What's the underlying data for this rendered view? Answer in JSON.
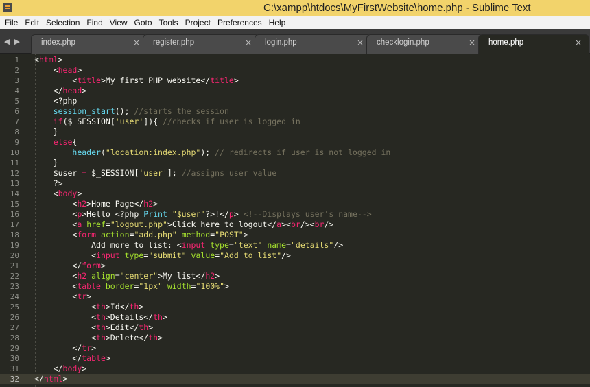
{
  "window": {
    "title": "C:\\xampp\\htdocs\\MyFirstWebsite\\home.php - Sublime Text"
  },
  "menu": [
    "File",
    "Edit",
    "Selection",
    "Find",
    "View",
    "Goto",
    "Tools",
    "Project",
    "Preferences",
    "Help"
  ],
  "tabs": [
    {
      "label": "index.php",
      "active": false
    },
    {
      "label": "register.php",
      "active": false
    },
    {
      "label": "login.php",
      "active": false
    },
    {
      "label": "checklogin.php",
      "active": false
    },
    {
      "label": "home.php",
      "active": true
    }
  ],
  "editor": {
    "current_line": 32,
    "lines": [
      "<html>",
      "    <head>",
      "        <title>My first PHP website</title>",
      "    </head>",
      "    <?php",
      "    session_start(); //starts the session",
      "    if($_SESSION['user']){ //checks if user is logged in",
      "    }",
      "    else{",
      "        header(\"location:index.php\"); // redirects if user is not logged in",
      "    }",
      "    $user = $_SESSION['user']; //assigns user value",
      "    ?>",
      "    <body>",
      "        <h2>Home Page</h2>",
      "        <p>Hello <?php Print \"$user\"?>!</p> <!--Displays user's name-->",
      "        <a href=\"logout.php\">Click here to logout</a><br/><br/>",
      "        <form action=\"add.php\" method=\"POST\">",
      "            Add more to list: <input type=\"text\" name=\"details\"/>",
      "            <input type=\"submit\" value=\"Add to list\"/>",
      "        </form>",
      "        <h2 align=\"center\">My list</h2>",
      "        <table border=\"1px\" width=\"100%\">",
      "        <tr>",
      "            <th>Id</th>",
      "            <th>Details</th>",
      "            <th>Edit</th>",
      "            <th>Delete</th>",
      "        </tr>",
      "        </table>",
      "    </body>",
      "</html>"
    ]
  },
  "colors": {
    "background": "#272822",
    "tag": "#f92672",
    "attribute": "#a6e22e",
    "string": "#e6db74",
    "comment": "#75715e",
    "function": "#66d9ef",
    "title_bar": "#f2d36b"
  },
  "icons": {
    "app": "sublime-text-icon",
    "tab_close": "close-icon",
    "nav_left": "chevron-left-icon",
    "nav_right": "chevron-right-icon"
  }
}
